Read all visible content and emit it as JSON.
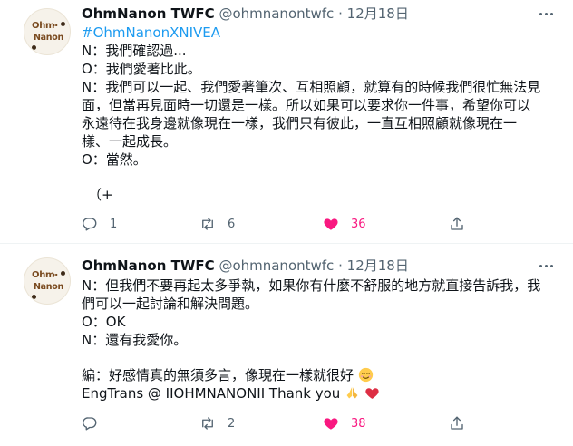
{
  "tweets": [
    {
      "author": {
        "name": "OhmNanon TWFC",
        "handle": "@ohmnanontwfc",
        "separator": "·",
        "date": "12月18日"
      },
      "avatar": {
        "line1": "Ohm",
        "line2": "Nanon"
      },
      "hashtag": "#OhmNanonXNIVEA",
      "lines": [
        "N：我們確認過...",
        "O：我們愛著比此。",
        "N：我們可以一起、我們愛著筆次、互相照顧，就算有的時候我們很忙無法見",
        "面，但當再見面時一切還是一樣。所以如果可以要求你一件事，希望你可以",
        "永遠待在我身邊就像現在一樣，我們只有彼此，一直互相照顧就像現在一",
        "樣、一起成長。",
        "O：當然。"
      ],
      "trailing": "（+",
      "stats": {
        "replies": "1",
        "retweets": "6",
        "likes": "36"
      }
    },
    {
      "author": {
        "name": "OhmNanon TWFC",
        "handle": "@ohmnanontwfc",
        "separator": "·",
        "date": "12月18日"
      },
      "avatar": {
        "line1": "Ohm",
        "line2": "Nanon"
      },
      "lines": [
        "N：但我們不要再起太多爭執，如果你有什麼不舒服的地方就直接告訴我，我",
        "們可以一起討論和解決問題。",
        "O：OK",
        "N：還有我愛你。"
      ],
      "editor_note": "編：好感情真的無須多言，像現在一樣就很好",
      "credit": "EngTrans @ IIOHMNANONII Thank you",
      "stats": {
        "replies": "",
        "retweets": "2",
        "likes": "38"
      }
    }
  ],
  "icons": {
    "reply": "reply-icon",
    "retweet": "retweet-icon",
    "like": "heart-filled-icon",
    "share": "share-icon",
    "more": "more-icon",
    "emoji_smile": "smiling-face-emoji",
    "emoji_pray": "folded-hands-emoji",
    "emoji_heart": "red-heart-emoji"
  },
  "colors": {
    "link": "#1d9bf0",
    "like_active": "#f91880",
    "muted": "#536471",
    "text": "#0f1419"
  }
}
